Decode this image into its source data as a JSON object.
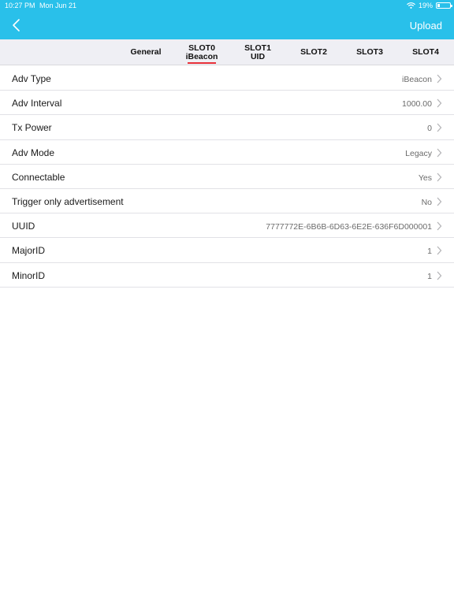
{
  "status_bar": {
    "time": "10:27 PM",
    "date": "Mon Jun 21",
    "battery": "19%",
    "battery_level": 0.19
  },
  "header": {
    "back_icon": "chevron-left-icon",
    "upload_label": "Upload",
    "background_color": "#29c0ea"
  },
  "tabs": [
    {
      "line1": "General",
      "line2": "",
      "selected": false
    },
    {
      "line1": "SLOT0",
      "line2": "iBeacon",
      "selected": true
    },
    {
      "line1": "SLOT1",
      "line2": "UID",
      "selected": false
    },
    {
      "line1": "SLOT2",
      "line2": "",
      "selected": false
    },
    {
      "line1": "SLOT3",
      "line2": "",
      "selected": false
    },
    {
      "line1": "SLOT4",
      "line2": "",
      "selected": false
    }
  ],
  "tab_indicator_color": "#e8313a",
  "settings": [
    {
      "label": "Adv Type",
      "value": "iBeacon"
    },
    {
      "label": "Adv Interval",
      "value": "1000.00"
    },
    {
      "label": "Tx Power",
      "value": "0"
    },
    {
      "label": "Adv Mode",
      "value": "Legacy"
    },
    {
      "label": "Connectable",
      "value": "Yes"
    },
    {
      "label": "Trigger only advertisement",
      "value": "No"
    },
    {
      "label": "UUID",
      "value": "7777772E-6B6B-6D63-6E2E-636F6D000001"
    },
    {
      "label": "MajorID",
      "value": "1"
    },
    {
      "label": "MinorID",
      "value": "1"
    }
  ]
}
